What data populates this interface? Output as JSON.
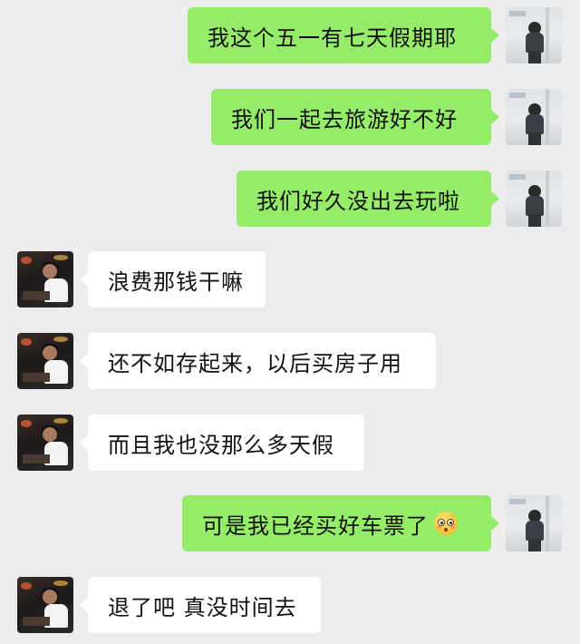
{
  "messages": [
    {
      "side": "right",
      "text": "我这个五一有七天假期耶"
    },
    {
      "side": "right",
      "text": "我们一起去旅游好不好"
    },
    {
      "side": "right",
      "text": "我们好久没出去玩啦"
    },
    {
      "side": "left",
      "text": "浪费那钱干嘛"
    },
    {
      "side": "left",
      "text": "还不如存起来，以后买房子用"
    },
    {
      "side": "left",
      "text": "而且我也没那么多天假"
    },
    {
      "side": "right",
      "text": "可是我已经买好车票了",
      "emoji": "flushed-face-emoji"
    },
    {
      "side": "left",
      "text": "退了吧 真没时间去"
    }
  ],
  "colors": {
    "background": "#ececec",
    "sent_bubble": "#95ec69",
    "received_bubble": "#ffffff",
    "text": "#111111"
  }
}
